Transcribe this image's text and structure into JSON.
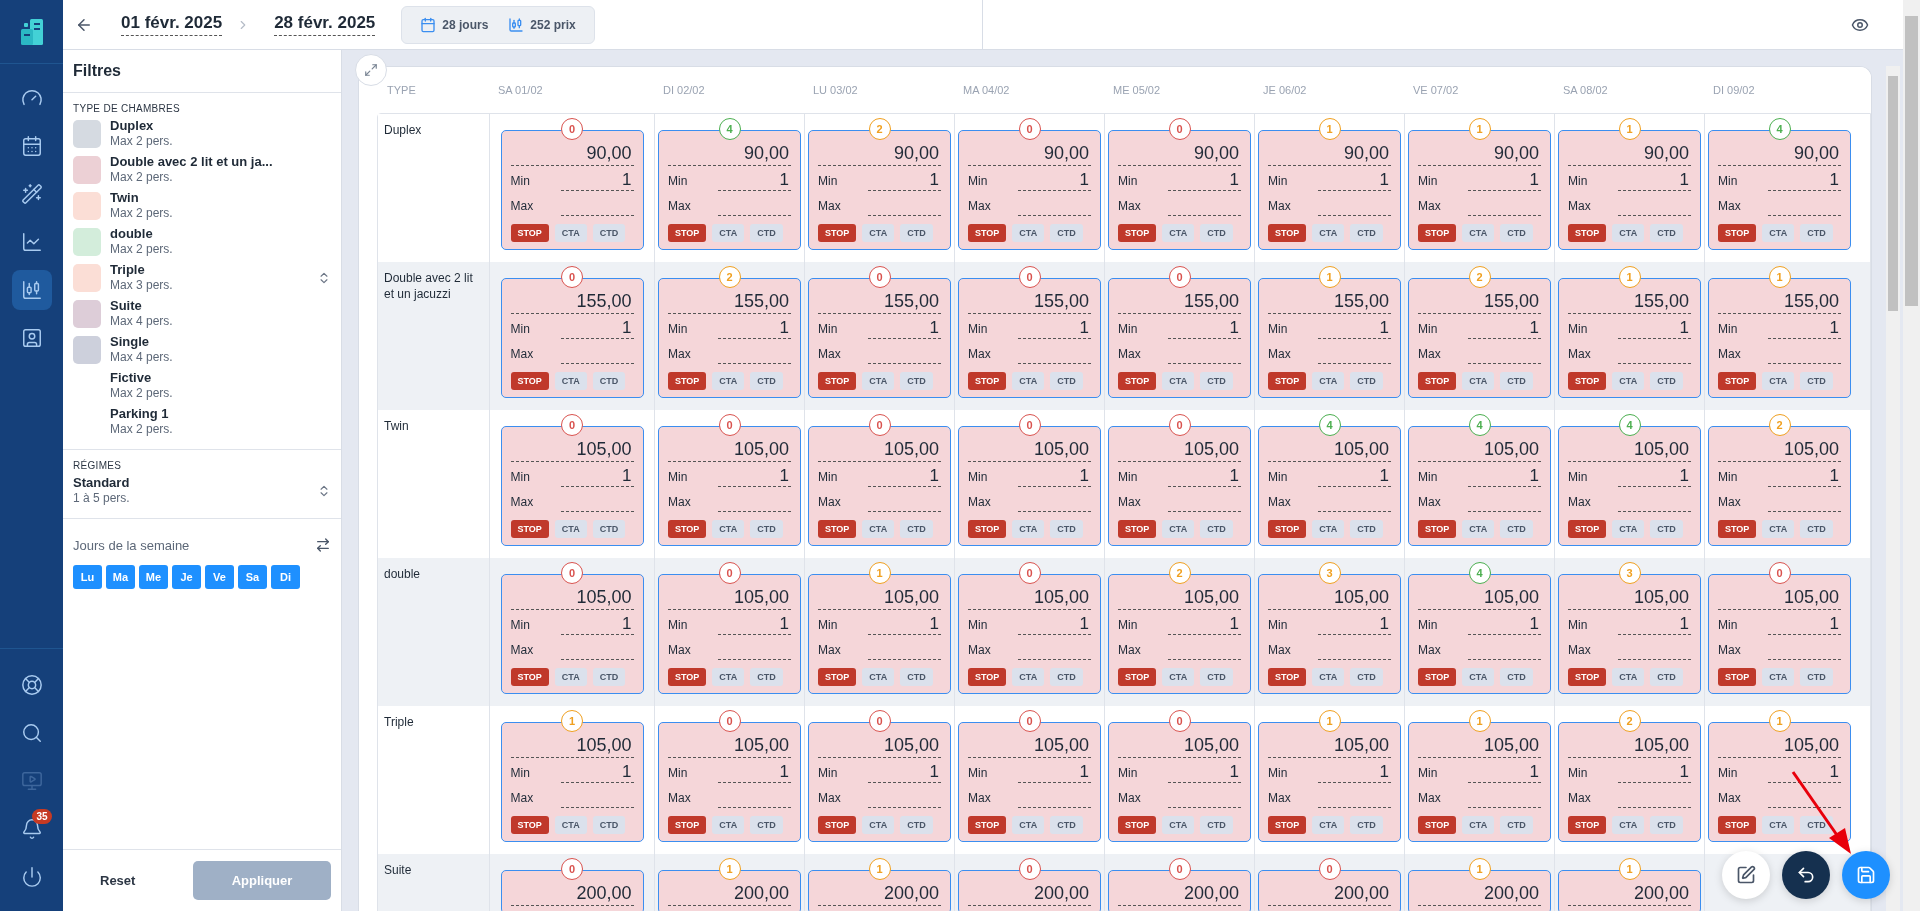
{
  "nav": {
    "top": [
      {
        "selected": false
      },
      {
        "selected": false
      },
      {
        "selected": false
      },
      {
        "selected": false
      },
      {
        "selected": true
      },
      {
        "selected": false
      }
    ],
    "bottom": [
      {
        "disabled": false
      },
      {
        "disabled": false
      },
      {
        "disabled": true
      },
      {
        "disabled": false,
        "badge": "35"
      },
      {
        "disabled": false
      }
    ]
  },
  "topbar": {
    "date_from": "01 févr. 2025",
    "date_to": "28 févr. 2025",
    "days": "28 jours",
    "prices": "252 prix"
  },
  "filters": {
    "title": "Filtres",
    "room_types_label": "TYPE DE CHAMBRES",
    "room_types": [
      {
        "name": "Duplex",
        "capacity": "Max 2 pers.",
        "color": "#d5dae1"
      },
      {
        "name": "Double avec 2 lit et un ja...",
        "capacity": "Max 2 pers.",
        "color": "#ecd0d5"
      },
      {
        "name": "Twin",
        "capacity": "Max 2 pers.",
        "color": "#fbded6"
      },
      {
        "name": "double",
        "capacity": "Max 2 pers.",
        "color": "#d3eddb"
      },
      {
        "name": "Triple",
        "capacity": "Max 3 pers.",
        "color": "#fbded6"
      },
      {
        "name": "Suite",
        "capacity": "Max 4 pers.",
        "color": "#ddcdd8"
      },
      {
        "name": "Single",
        "capacity": "Max 4 pers.",
        "color": "#cdd0dc"
      },
      {
        "name": "Fictive",
        "capacity": "Max 2 pers."
      },
      {
        "name": "Parking 1",
        "capacity": "Max 2 pers."
      }
    ],
    "regimes_label": "RÉGIMES",
    "regime": {
      "name": "Standard",
      "capacity": "1 à 5 pers."
    },
    "weekdays_label": "Jours de la semaine",
    "weekdays": [
      {
        "label": "Lu",
        "selected": true
      },
      {
        "label": "Ma",
        "selected": true
      },
      {
        "label": "Me",
        "selected": true
      },
      {
        "label": "Je",
        "selected": true
      },
      {
        "label": "Ve",
        "selected": true
      },
      {
        "label": "Sa",
        "selected": true
      },
      {
        "label": "Di",
        "selected": true
      }
    ],
    "reset": "Reset",
    "apply": {
      "label": "Appliquer",
      "disabled": true
    }
  },
  "table": {
    "type_header": "TYPE",
    "dates": [
      "SA 01/02",
      "DI 02/02",
      "LU 03/02",
      "MA 04/02",
      "ME 05/02",
      "JE 06/02",
      "VE 07/02",
      "SA 08/02",
      "DI 09/02"
    ],
    "rows": [
      {
        "name": "Duplex",
        "cells": [
          {
            "count": "0",
            "color": "#d9534f",
            "price": "90,00",
            "min_label": "Min",
            "min": "1",
            "max_label": "Max",
            "flags": [
              {
                "label": "STOP",
                "on": true
              },
              {
                "label": "CTA",
                "on": false
              },
              {
                "label": "CTD",
                "on": false
              }
            ]
          },
          {
            "count": "4",
            "color": "#4caf50",
            "price": "90,00",
            "min_label": "Min",
            "min": "1",
            "max_label": "Max",
            "flags": [
              {
                "label": "STOP",
                "on": true
              },
              {
                "label": "CTA",
                "on": false
              },
              {
                "label": "CTD",
                "on": false
              }
            ]
          },
          {
            "count": "2",
            "color": "#f0a020",
            "price": "90,00",
            "min_label": "Min",
            "min": "1",
            "max_label": "Max",
            "flags": [
              {
                "label": "STOP",
                "on": true
              },
              {
                "label": "CTA",
                "on": false
              },
              {
                "label": "CTD",
                "on": false
              }
            ]
          },
          {
            "count": "0",
            "color": "#d9534f",
            "price": "90,00",
            "min_label": "Min",
            "min": "1",
            "max_label": "Max",
            "flags": [
              {
                "label": "STOP",
                "on": true
              },
              {
                "label": "CTA",
                "on": false
              },
              {
                "label": "CTD",
                "on": false
              }
            ]
          },
          {
            "count": "0",
            "color": "#d9534f",
            "price": "90,00",
            "min_label": "Min",
            "min": "1",
            "max_label": "Max",
            "flags": [
              {
                "label": "STOP",
                "on": true
              },
              {
                "label": "CTA",
                "on": false
              },
              {
                "label": "CTD",
                "on": false
              }
            ]
          },
          {
            "count": "1",
            "color": "#f0a020",
            "price": "90,00",
            "min_label": "Min",
            "min": "1",
            "max_label": "Max",
            "flags": [
              {
                "label": "STOP",
                "on": true
              },
              {
                "label": "CTA",
                "on": false
              },
              {
                "label": "CTD",
                "on": false
              }
            ]
          },
          {
            "count": "1",
            "color": "#f0a020",
            "price": "90,00",
            "min_label": "Min",
            "min": "1",
            "max_label": "Max",
            "flags": [
              {
                "label": "STOP",
                "on": true
              },
              {
                "label": "CTA",
                "on": false
              },
              {
                "label": "CTD",
                "on": false
              }
            ]
          },
          {
            "count": "1",
            "color": "#f0a020",
            "price": "90,00",
            "min_label": "Min",
            "min": "1",
            "max_label": "Max",
            "flags": [
              {
                "label": "STOP",
                "on": true
              },
              {
                "label": "CTA",
                "on": false
              },
              {
                "label": "CTD",
                "on": false
              }
            ]
          },
          {
            "count": "4",
            "color": "#4caf50",
            "price": "90,00",
            "min_label": "Min",
            "min": "1",
            "max_label": "Max",
            "flags": [
              {
                "label": "STOP",
                "on": true
              },
              {
                "label": "CTA",
                "on": false
              },
              {
                "label": "CTD",
                "on": false
              }
            ]
          }
        ]
      },
      {
        "name": "Double avec 2 lit et un jacuzzi",
        "cells": [
          {
            "count": "0",
            "color": "#d9534f",
            "price": "155,00",
            "min_label": "Min",
            "min": "1",
            "max_label": "Max",
            "flags": [
              {
                "label": "STOP",
                "on": true
              },
              {
                "label": "CTA",
                "on": false
              },
              {
                "label": "CTD",
                "on": false
              }
            ]
          },
          {
            "count": "2",
            "color": "#f0a020",
            "price": "155,00",
            "min_label": "Min",
            "min": "1",
            "max_label": "Max",
            "flags": [
              {
                "label": "STOP",
                "on": true
              },
              {
                "label": "CTA",
                "on": false
              },
              {
                "label": "CTD",
                "on": false
              }
            ]
          },
          {
            "count": "0",
            "color": "#d9534f",
            "price": "155,00",
            "min_label": "Min",
            "min": "1",
            "max_label": "Max",
            "flags": [
              {
                "label": "STOP",
                "on": true
              },
              {
                "label": "CTA",
                "on": false
              },
              {
                "label": "CTD",
                "on": false
              }
            ]
          },
          {
            "count": "0",
            "color": "#d9534f",
            "price": "155,00",
            "min_label": "Min",
            "min": "1",
            "max_label": "Max",
            "flags": [
              {
                "label": "STOP",
                "on": true
              },
              {
                "label": "CTA",
                "on": false
              },
              {
                "label": "CTD",
                "on": false
              }
            ]
          },
          {
            "count": "0",
            "color": "#d9534f",
            "price": "155,00",
            "min_label": "Min",
            "min": "1",
            "max_label": "Max",
            "flags": [
              {
                "label": "STOP",
                "on": true
              },
              {
                "label": "CTA",
                "on": false
              },
              {
                "label": "CTD",
                "on": false
              }
            ]
          },
          {
            "count": "1",
            "color": "#f0a020",
            "price": "155,00",
            "min_label": "Min",
            "min": "1",
            "max_label": "Max",
            "flags": [
              {
                "label": "STOP",
                "on": true
              },
              {
                "label": "CTA",
                "on": false
              },
              {
                "label": "CTD",
                "on": false
              }
            ]
          },
          {
            "count": "2",
            "color": "#f0a020",
            "price": "155,00",
            "min_label": "Min",
            "min": "1",
            "max_label": "Max",
            "flags": [
              {
                "label": "STOP",
                "on": true
              },
              {
                "label": "CTA",
                "on": false
              },
              {
                "label": "CTD",
                "on": false
              }
            ]
          },
          {
            "count": "1",
            "color": "#f0a020",
            "price": "155,00",
            "min_label": "Min",
            "min": "1",
            "max_label": "Max",
            "flags": [
              {
                "label": "STOP",
                "on": true
              },
              {
                "label": "CTA",
                "on": false
              },
              {
                "label": "CTD",
                "on": false
              }
            ]
          },
          {
            "count": "1",
            "color": "#f0a020",
            "price": "155,00",
            "min_label": "Min",
            "min": "1",
            "max_label": "Max",
            "flags": [
              {
                "label": "STOP",
                "on": true
              },
              {
                "label": "CTA",
                "on": false
              },
              {
                "label": "CTD",
                "on": false
              }
            ]
          }
        ]
      },
      {
        "name": "Twin",
        "cells": [
          {
            "count": "0",
            "color": "#d9534f",
            "price": "105,00",
            "min_label": "Min",
            "min": "1",
            "max_label": "Max",
            "flags": [
              {
                "label": "STOP",
                "on": true
              },
              {
                "label": "CTA",
                "on": false
              },
              {
                "label": "CTD",
                "on": false
              }
            ]
          },
          {
            "count": "0",
            "color": "#d9534f",
            "price": "105,00",
            "min_label": "Min",
            "min": "1",
            "max_label": "Max",
            "flags": [
              {
                "label": "STOP",
                "on": true
              },
              {
                "label": "CTA",
                "on": false
              },
              {
                "label": "CTD",
                "on": false
              }
            ]
          },
          {
            "count": "0",
            "color": "#d9534f",
            "price": "105,00",
            "min_label": "Min",
            "min": "1",
            "max_label": "Max",
            "flags": [
              {
                "label": "STOP",
                "on": true
              },
              {
                "label": "CTA",
                "on": false
              },
              {
                "label": "CTD",
                "on": false
              }
            ]
          },
          {
            "count": "0",
            "color": "#d9534f",
            "price": "105,00",
            "min_label": "Min",
            "min": "1",
            "max_label": "Max",
            "flags": [
              {
                "label": "STOP",
                "on": true
              },
              {
                "label": "CTA",
                "on": false
              },
              {
                "label": "CTD",
                "on": false
              }
            ]
          },
          {
            "count": "0",
            "color": "#d9534f",
            "price": "105,00",
            "min_label": "Min",
            "min": "1",
            "max_label": "Max",
            "flags": [
              {
                "label": "STOP",
                "on": true
              },
              {
                "label": "CTA",
                "on": false
              },
              {
                "label": "CTD",
                "on": false
              }
            ]
          },
          {
            "count": "4",
            "color": "#4caf50",
            "price": "105,00",
            "min_label": "Min",
            "min": "1",
            "max_label": "Max",
            "flags": [
              {
                "label": "STOP",
                "on": true
              },
              {
                "label": "CTA",
                "on": false
              },
              {
                "label": "CTD",
                "on": false
              }
            ]
          },
          {
            "count": "4",
            "color": "#4caf50",
            "price": "105,00",
            "min_label": "Min",
            "min": "1",
            "max_label": "Max",
            "flags": [
              {
                "label": "STOP",
                "on": true
              },
              {
                "label": "CTA",
                "on": false
              },
              {
                "label": "CTD",
                "on": false
              }
            ]
          },
          {
            "count": "4",
            "color": "#4caf50",
            "price": "105,00",
            "min_label": "Min",
            "min": "1",
            "max_label": "Max",
            "flags": [
              {
                "label": "STOP",
                "on": true
              },
              {
                "label": "CTA",
                "on": false
              },
              {
                "label": "CTD",
                "on": false
              }
            ]
          },
          {
            "count": "2",
            "color": "#f0a020",
            "price": "105,00",
            "min_label": "Min",
            "min": "1",
            "max_label": "Max",
            "flags": [
              {
                "label": "STOP",
                "on": true
              },
              {
                "label": "CTA",
                "on": false
              },
              {
                "label": "CTD",
                "on": false
              }
            ]
          }
        ]
      },
      {
        "name": "double",
        "cells": [
          {
            "count": "0",
            "color": "#d9534f",
            "price": "105,00",
            "min_label": "Min",
            "min": "1",
            "max_label": "Max",
            "flags": [
              {
                "label": "STOP",
                "on": true
              },
              {
                "label": "CTA",
                "on": false
              },
              {
                "label": "CTD",
                "on": false
              }
            ]
          },
          {
            "count": "0",
            "color": "#d9534f",
            "price": "105,00",
            "min_label": "Min",
            "min": "1",
            "max_label": "Max",
            "flags": [
              {
                "label": "STOP",
                "on": true
              },
              {
                "label": "CTA",
                "on": false
              },
              {
                "label": "CTD",
                "on": false
              }
            ]
          },
          {
            "count": "1",
            "color": "#f0a020",
            "price": "105,00",
            "min_label": "Min",
            "min": "1",
            "max_label": "Max",
            "flags": [
              {
                "label": "STOP",
                "on": true
              },
              {
                "label": "CTA",
                "on": false
              },
              {
                "label": "CTD",
                "on": false
              }
            ]
          },
          {
            "count": "0",
            "color": "#d9534f",
            "price": "105,00",
            "min_label": "Min",
            "min": "1",
            "max_label": "Max",
            "flags": [
              {
                "label": "STOP",
                "on": true
              },
              {
                "label": "CTA",
                "on": false
              },
              {
                "label": "CTD",
                "on": false
              }
            ]
          },
          {
            "count": "2",
            "color": "#f0a020",
            "price": "105,00",
            "min_label": "Min",
            "min": "1",
            "max_label": "Max",
            "flags": [
              {
                "label": "STOP",
                "on": true
              },
              {
                "label": "CTA",
                "on": false
              },
              {
                "label": "CTD",
                "on": false
              }
            ]
          },
          {
            "count": "3",
            "color": "#f0a020",
            "price": "105,00",
            "min_label": "Min",
            "min": "1",
            "max_label": "Max",
            "flags": [
              {
                "label": "STOP",
                "on": true
              },
              {
                "label": "CTA",
                "on": false
              },
              {
                "label": "CTD",
                "on": false
              }
            ]
          },
          {
            "count": "4",
            "color": "#4caf50",
            "price": "105,00",
            "min_label": "Min",
            "min": "1",
            "max_label": "Max",
            "flags": [
              {
                "label": "STOP",
                "on": true
              },
              {
                "label": "CTA",
                "on": false
              },
              {
                "label": "CTD",
                "on": false
              }
            ]
          },
          {
            "count": "3",
            "color": "#f0a020",
            "price": "105,00",
            "min_label": "Min",
            "min": "1",
            "max_label": "Max",
            "flags": [
              {
                "label": "STOP",
                "on": true
              },
              {
                "label": "CTA",
                "on": false
              },
              {
                "label": "CTD",
                "on": false
              }
            ]
          },
          {
            "count": "0",
            "color": "#d9534f",
            "price": "105,00",
            "min_label": "Min",
            "min": "1",
            "max_label": "Max",
            "flags": [
              {
                "label": "STOP",
                "on": true
              },
              {
                "label": "CTA",
                "on": false
              },
              {
                "label": "CTD",
                "on": false
              }
            ]
          }
        ]
      },
      {
        "name": "Triple",
        "cells": [
          {
            "count": "1",
            "color": "#f0a020",
            "price": "105,00",
            "min_label": "Min",
            "min": "1",
            "max_label": "Max",
            "flags": [
              {
                "label": "STOP",
                "on": true
              },
              {
                "label": "CTA",
                "on": false
              },
              {
                "label": "CTD",
                "on": false
              }
            ]
          },
          {
            "count": "0",
            "color": "#d9534f",
            "price": "105,00",
            "min_label": "Min",
            "min": "1",
            "max_label": "Max",
            "flags": [
              {
                "label": "STOP",
                "on": true
              },
              {
                "label": "CTA",
                "on": false
              },
              {
                "label": "CTD",
                "on": false
              }
            ]
          },
          {
            "count": "0",
            "color": "#d9534f",
            "price": "105,00",
            "min_label": "Min",
            "min": "1",
            "max_label": "Max",
            "flags": [
              {
                "label": "STOP",
                "on": true
              },
              {
                "label": "CTA",
                "on": false
              },
              {
                "label": "CTD",
                "on": false
              }
            ]
          },
          {
            "count": "0",
            "color": "#d9534f",
            "price": "105,00",
            "min_label": "Min",
            "min": "1",
            "max_label": "Max",
            "flags": [
              {
                "label": "STOP",
                "on": true
              },
              {
                "label": "CTA",
                "on": false
              },
              {
                "label": "CTD",
                "on": false
              }
            ]
          },
          {
            "count": "0",
            "color": "#d9534f",
            "price": "105,00",
            "min_label": "Min",
            "min": "1",
            "max_label": "Max",
            "flags": [
              {
                "label": "STOP",
                "on": true
              },
              {
                "label": "CTA",
                "on": false
              },
              {
                "label": "CTD",
                "on": false
              }
            ]
          },
          {
            "count": "1",
            "color": "#f0a020",
            "price": "105,00",
            "min_label": "Min",
            "min": "1",
            "max_label": "Max",
            "flags": [
              {
                "label": "STOP",
                "on": true
              },
              {
                "label": "CTA",
                "on": false
              },
              {
                "label": "CTD",
                "on": false
              }
            ]
          },
          {
            "count": "1",
            "color": "#f0a020",
            "price": "105,00",
            "min_label": "Min",
            "min": "1",
            "max_label": "Max",
            "flags": [
              {
                "label": "STOP",
                "on": true
              },
              {
                "label": "CTA",
                "on": false
              },
              {
                "label": "CTD",
                "on": false
              }
            ]
          },
          {
            "count": "2",
            "color": "#f0a020",
            "price": "105,00",
            "min_label": "Min",
            "min": "1",
            "max_label": "Max",
            "flags": [
              {
                "label": "STOP",
                "on": true
              },
              {
                "label": "CTA",
                "on": false
              },
              {
                "label": "CTD",
                "on": false
              }
            ]
          },
          {
            "count": "1",
            "color": "#f0a020",
            "price": "105,00",
            "min_label": "Min",
            "min": "1",
            "max_label": "Max",
            "flags": [
              {
                "label": "STOP",
                "on": true
              },
              {
                "label": "CTA",
                "on": false
              },
              {
                "label": "CTD",
                "on": false
              }
            ]
          }
        ]
      },
      {
        "name": "Suite",
        "cells": [
          {
            "count": "0",
            "color": "#d9534f",
            "price": "200,00"
          },
          {
            "count": "1",
            "color": "#f0a020",
            "price": "200,00"
          },
          {
            "count": "1",
            "color": "#f0a020",
            "price": "200,00"
          },
          {
            "count": "0",
            "color": "#d9534f",
            "price": "200,00"
          },
          {
            "count": "0",
            "color": "#d9534f",
            "price": "200,00"
          },
          {
            "count": "0",
            "color": "#d9534f",
            "price": "200,00"
          },
          {
            "count": "1",
            "color": "#f0a020",
            "price": "200,00"
          },
          {
            "count": "1",
            "color": "#f0a020",
            "price": "200,00"
          }
        ]
      }
    ]
  }
}
